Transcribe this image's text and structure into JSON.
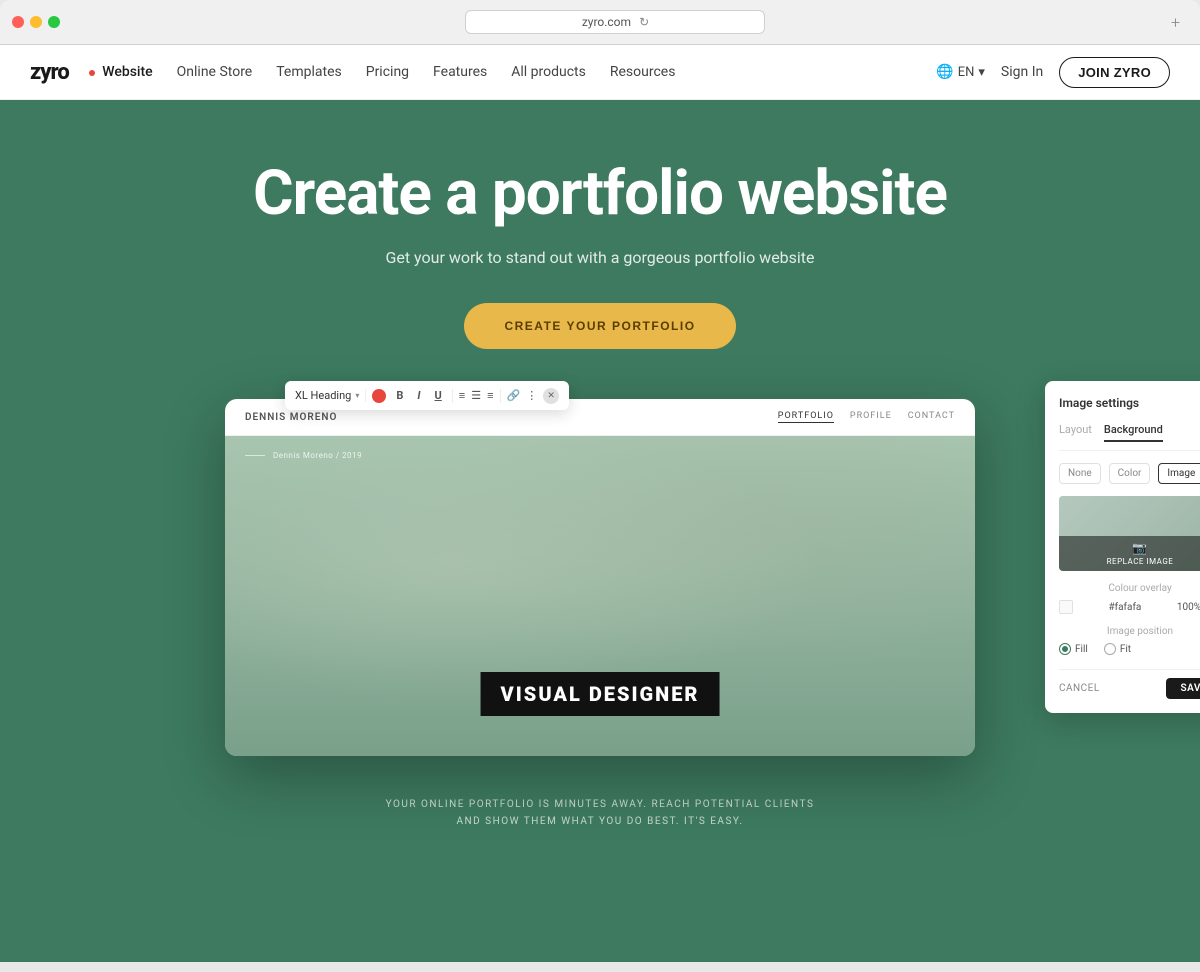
{
  "browser": {
    "url": "zyro.com",
    "new_tab_label": "+"
  },
  "nav": {
    "logo": "zyro",
    "dot_label": "•",
    "links": [
      {
        "id": "website",
        "label": "Website",
        "active": true
      },
      {
        "id": "online-store",
        "label": "Online Store",
        "active": false
      },
      {
        "id": "templates",
        "label": "Templates",
        "active": false
      },
      {
        "id": "pricing",
        "label": "Pricing",
        "active": false
      },
      {
        "id": "features",
        "label": "Features",
        "active": false
      },
      {
        "id": "all-products",
        "label": "All products",
        "active": false
      },
      {
        "id": "resources",
        "label": "Resources",
        "active": false
      }
    ],
    "lang": "EN",
    "sign_in": "Sign In",
    "join_btn": "JOIN ZYRO"
  },
  "hero": {
    "title": "Create a portfolio website",
    "subtitle": "Get your work to stand out with a gorgeous portfolio website",
    "cta_btn": "CREATE YOUR PORTFOLIO",
    "tagline_line1": "YOUR ONLINE PORTFOLIO IS MINUTES AWAY. REACH POTENTIAL CLIENTS",
    "tagline_line2": "AND SHOW THEM WHAT YOU DO BEST. IT'S EASY."
  },
  "preview": {
    "brand_name": "DENNIS MORENO",
    "nav_links": [
      "PORTFOLIO",
      "PROFILE",
      "CONTACT"
    ],
    "active_nav": "PORTFOLIO",
    "caption": "Dennis Moreno / 2019",
    "designer_label": "VISUAL DESIGNER"
  },
  "toolbar": {
    "style_select": "XL Heading",
    "bold": "B",
    "italic": "I",
    "underline": "U"
  },
  "image_settings": {
    "title": "Image settings",
    "tabs": [
      "Layout",
      "Background"
    ],
    "active_tab": "Background",
    "options": [
      "None",
      "Color",
      "Image"
    ],
    "active_option": "Image",
    "replace_label": "REPLACE IMAGE",
    "colour_overlay_label": "Colour overlay",
    "color_hex": "#fafafa",
    "color_pct": "100%",
    "image_position_label": "Image position",
    "radio_fill": "Fill",
    "radio_fit": "Fit",
    "cancel_label": "CANCEL",
    "save_label": "SAVE"
  }
}
